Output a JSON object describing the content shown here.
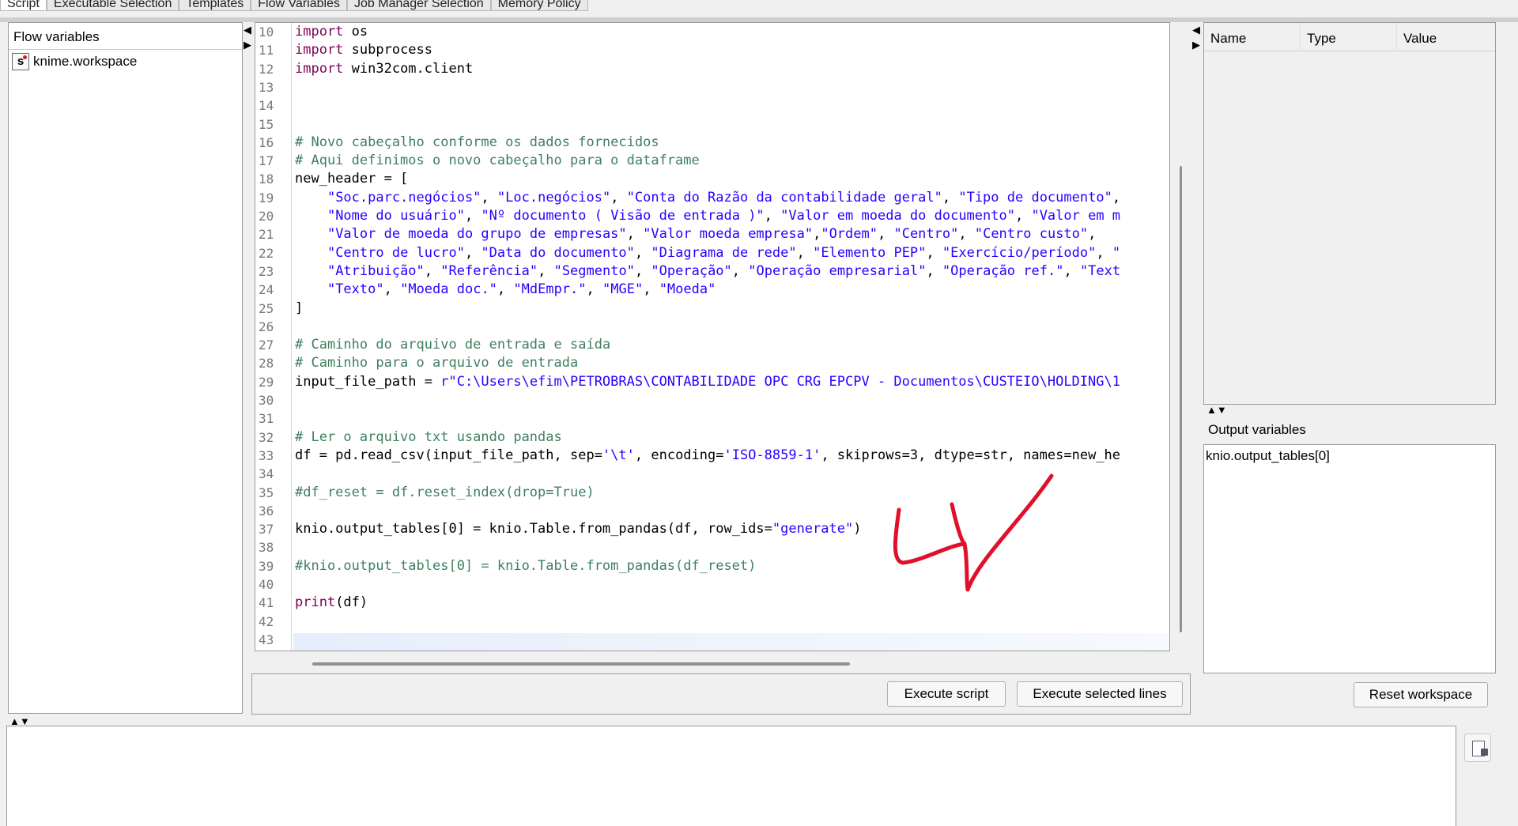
{
  "tabs": [
    "Script",
    "Executable Selection",
    "Templates",
    "Flow Variables",
    "Job Manager Selection",
    "Memory Policy"
  ],
  "flow_panel": {
    "header": "Flow variables",
    "items": [
      {
        "icon": "string-variable-icon",
        "label": "knime.workspace"
      }
    ]
  },
  "editor": {
    "lines": [
      {
        "n": "10",
        "html": "<span class='kw'>import</span> os"
      },
      {
        "n": "11",
        "html": "<span class='kw'>import</span> subprocess"
      },
      {
        "n": "12",
        "html": "<span class='kw'>import</span> win32com.client"
      },
      {
        "n": "13",
        "html": ""
      },
      {
        "n": "14",
        "html": ""
      },
      {
        "n": "15",
        "html": ""
      },
      {
        "n": "16",
        "html": "<span class='cm'># Novo cabeçalho conforme os dados fornecidos</span>"
      },
      {
        "n": "17",
        "html": "<span class='cm'># Aqui definimos o novo cabeçalho para o dataframe</span>"
      },
      {
        "n": "18",
        "html": "new_header = ["
      },
      {
        "n": "19",
        "html": "    <span class='st'>\"Soc.parc.negócios\"</span>, <span class='st'>\"Loc.negócios\"</span>, <span class='st'>\"Conta do Razão da contabilidade geral\"</span>, <span class='st'>\"Tipo de documento\"</span>,"
      },
      {
        "n": "20",
        "html": "    <span class='st'>\"Nome do usuário\"</span>, <span class='st'>\"Nº documento ( Visão de entrada )\"</span>, <span class='st'>\"Valor em moeda do documento\"</span>, <span class='st'>\"Valor em m</span>"
      },
      {
        "n": "21",
        "html": "    <span class='st'>\"Valor de moeda do grupo de empresas\"</span>, <span class='st'>\"Valor moeda empresa\"</span>,<span class='st'>\"Ordem\"</span>, <span class='st'>\"Centro\"</span>, <span class='st'>\"Centro custo\"</span>,"
      },
      {
        "n": "22",
        "html": "    <span class='st'>\"Centro de lucro\"</span>, <span class='st'>\"Data do documento\"</span>, <span class='st'>\"Diagrama de rede\"</span>, <span class='st'>\"Elemento PEP\"</span>, <span class='st'>\"Exercício/período\"</span>, <span class='st'>\"</span>"
      },
      {
        "n": "23",
        "html": "    <span class='st'>\"Atribuição\"</span>, <span class='st'>\"Referência\"</span>, <span class='st'>\"Segmento\"</span>, <span class='st'>\"Operação\"</span>, <span class='st'>\"Operação empresarial\"</span>, <span class='st'>\"Operação ref.\"</span>, <span class='st'>\"Text</span>"
      },
      {
        "n": "24",
        "html": "    <span class='st'>\"Texto\"</span>, <span class='st'>\"Moeda doc.\"</span>, <span class='st'>\"MdEmpr.\"</span>, <span class='st'>\"MGE\"</span>, <span class='st'>\"Moeda\"</span>"
      },
      {
        "n": "25",
        "html": "]"
      },
      {
        "n": "26",
        "html": ""
      },
      {
        "n": "27",
        "html": "<span class='cm'># Caminho do arquivo de entrada e saída</span>"
      },
      {
        "n": "28",
        "html": "<span class='cm'># Caminho para o arquivo de entrada</span>"
      },
      {
        "n": "29",
        "html": "input_file_path = <span class='st'>r\"C:\\Users\\efim\\PETROBRAS\\CONTABILIDADE OPC CRG EPCPV - Documentos\\CUSTEIO\\HOLDING\\1</span>"
      },
      {
        "n": "30",
        "html": ""
      },
      {
        "n": "31",
        "html": ""
      },
      {
        "n": "32",
        "html": "<span class='cm'># Ler o arquivo txt usando pandas</span>"
      },
      {
        "n": "33",
        "html": "df = pd.read_csv(input_file_path, sep=<span class='st'>'\\t'</span>, encoding=<span class='st'>'ISO-8859-1'</span>, skiprows=3, dtype=str, names=new_he"
      },
      {
        "n": "34",
        "html": ""
      },
      {
        "n": "35",
        "html": "<span class='cm'>#df_reset = df.reset_index(drop=True)</span>"
      },
      {
        "n": "36",
        "html": ""
      },
      {
        "n": "37",
        "html": "knio.output_tables[0] = knio.Table.from_pandas(df, row_ids=<span class='st'>\"generate\"</span>)"
      },
      {
        "n": "38",
        "html": ""
      },
      {
        "n": "39",
        "html": "<span class='cm'>#knio.output_tables[0] = knio.Table.from_pandas(df_reset)</span>"
      },
      {
        "n": "40",
        "html": ""
      },
      {
        "n": "41",
        "html": "<span class='kw'>print</span>(df)"
      },
      {
        "n": "42",
        "html": ""
      },
      {
        "n": "43",
        "html": ""
      }
    ]
  },
  "buttons": {
    "execute_script": "Execute script",
    "execute_selected": "Execute selected lines",
    "reset_workspace": "Reset workspace"
  },
  "vars_table": {
    "columns": [
      "Name",
      "Type",
      "Value"
    ]
  },
  "output_vars": {
    "header": "Output variables",
    "items": [
      "knio.output_tables[0]"
    ]
  },
  "colors": {
    "keyword": "#7f0055",
    "comment": "#3f7f5f",
    "string": "#2a00ff",
    "annotation": "#e0102a"
  }
}
